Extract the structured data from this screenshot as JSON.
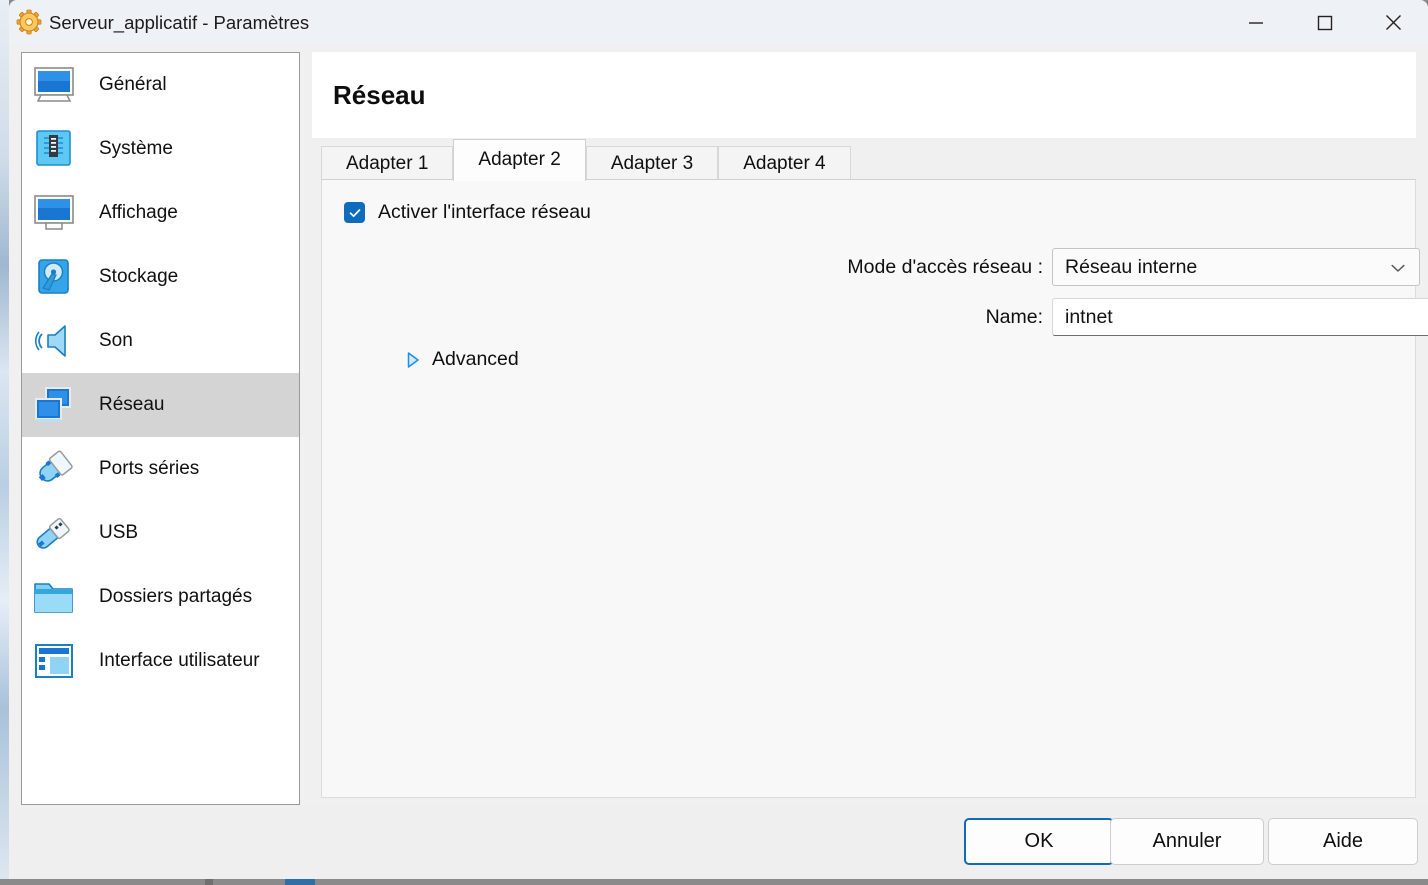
{
  "window": {
    "title": "Serveur_applicatif - Paramètres",
    "app_icon": "gear-icon",
    "controls": {
      "minimize": "minimize-icon",
      "maximize": "maximize-icon",
      "close": "close-icon"
    }
  },
  "sidebar": {
    "items": [
      {
        "label": "Général",
        "icon": "monitor-icon",
        "selected": false
      },
      {
        "label": "Système",
        "icon": "chip-icon",
        "selected": false
      },
      {
        "label": "Affichage",
        "icon": "display-icon",
        "selected": false
      },
      {
        "label": "Stockage",
        "icon": "harddisk-icon",
        "selected": false
      },
      {
        "label": "Son",
        "icon": "speaker-icon",
        "selected": false
      },
      {
        "label": "Réseau",
        "icon": "network-icon",
        "selected": true
      },
      {
        "label": "Ports séries",
        "icon": "serial-port-icon",
        "selected": false
      },
      {
        "label": "USB",
        "icon": "usb-icon",
        "selected": false
      },
      {
        "label": "Dossiers partagés",
        "icon": "folder-icon",
        "selected": false
      },
      {
        "label": "Interface utilisateur",
        "icon": "layout-icon",
        "selected": false
      }
    ]
  },
  "page": {
    "title": "Réseau",
    "tabs": [
      {
        "label": "Adapter 1",
        "active": false
      },
      {
        "label": "Adapter 2",
        "active": true
      },
      {
        "label": "Adapter 3",
        "active": false
      },
      {
        "label": "Adapter 4",
        "active": false
      }
    ],
    "form": {
      "enable_checkbox": {
        "label": "Activer l'interface réseau",
        "checked": true
      },
      "attached_to": {
        "label": "Mode d'accès réseau :",
        "value": "Réseau interne",
        "arrow_icon": "chevron-down-icon"
      },
      "name": {
        "label": "Name:",
        "value": "intnet",
        "arrow_icon": "chevron-down-icon"
      },
      "advanced": {
        "label": "Advanced",
        "expanded": false,
        "toggle_icon": "triangle-right-icon"
      }
    }
  },
  "footer": {
    "ok": "OK",
    "cancel": "Annuler",
    "help": "Aide"
  },
  "colors": {
    "accent": "#0f6cbd",
    "selection": "#d4d4d4",
    "window_bg": "#f0f0f0",
    "titlebar_bg": "#eef2f7",
    "panel_bg": "#f8f8f8"
  }
}
